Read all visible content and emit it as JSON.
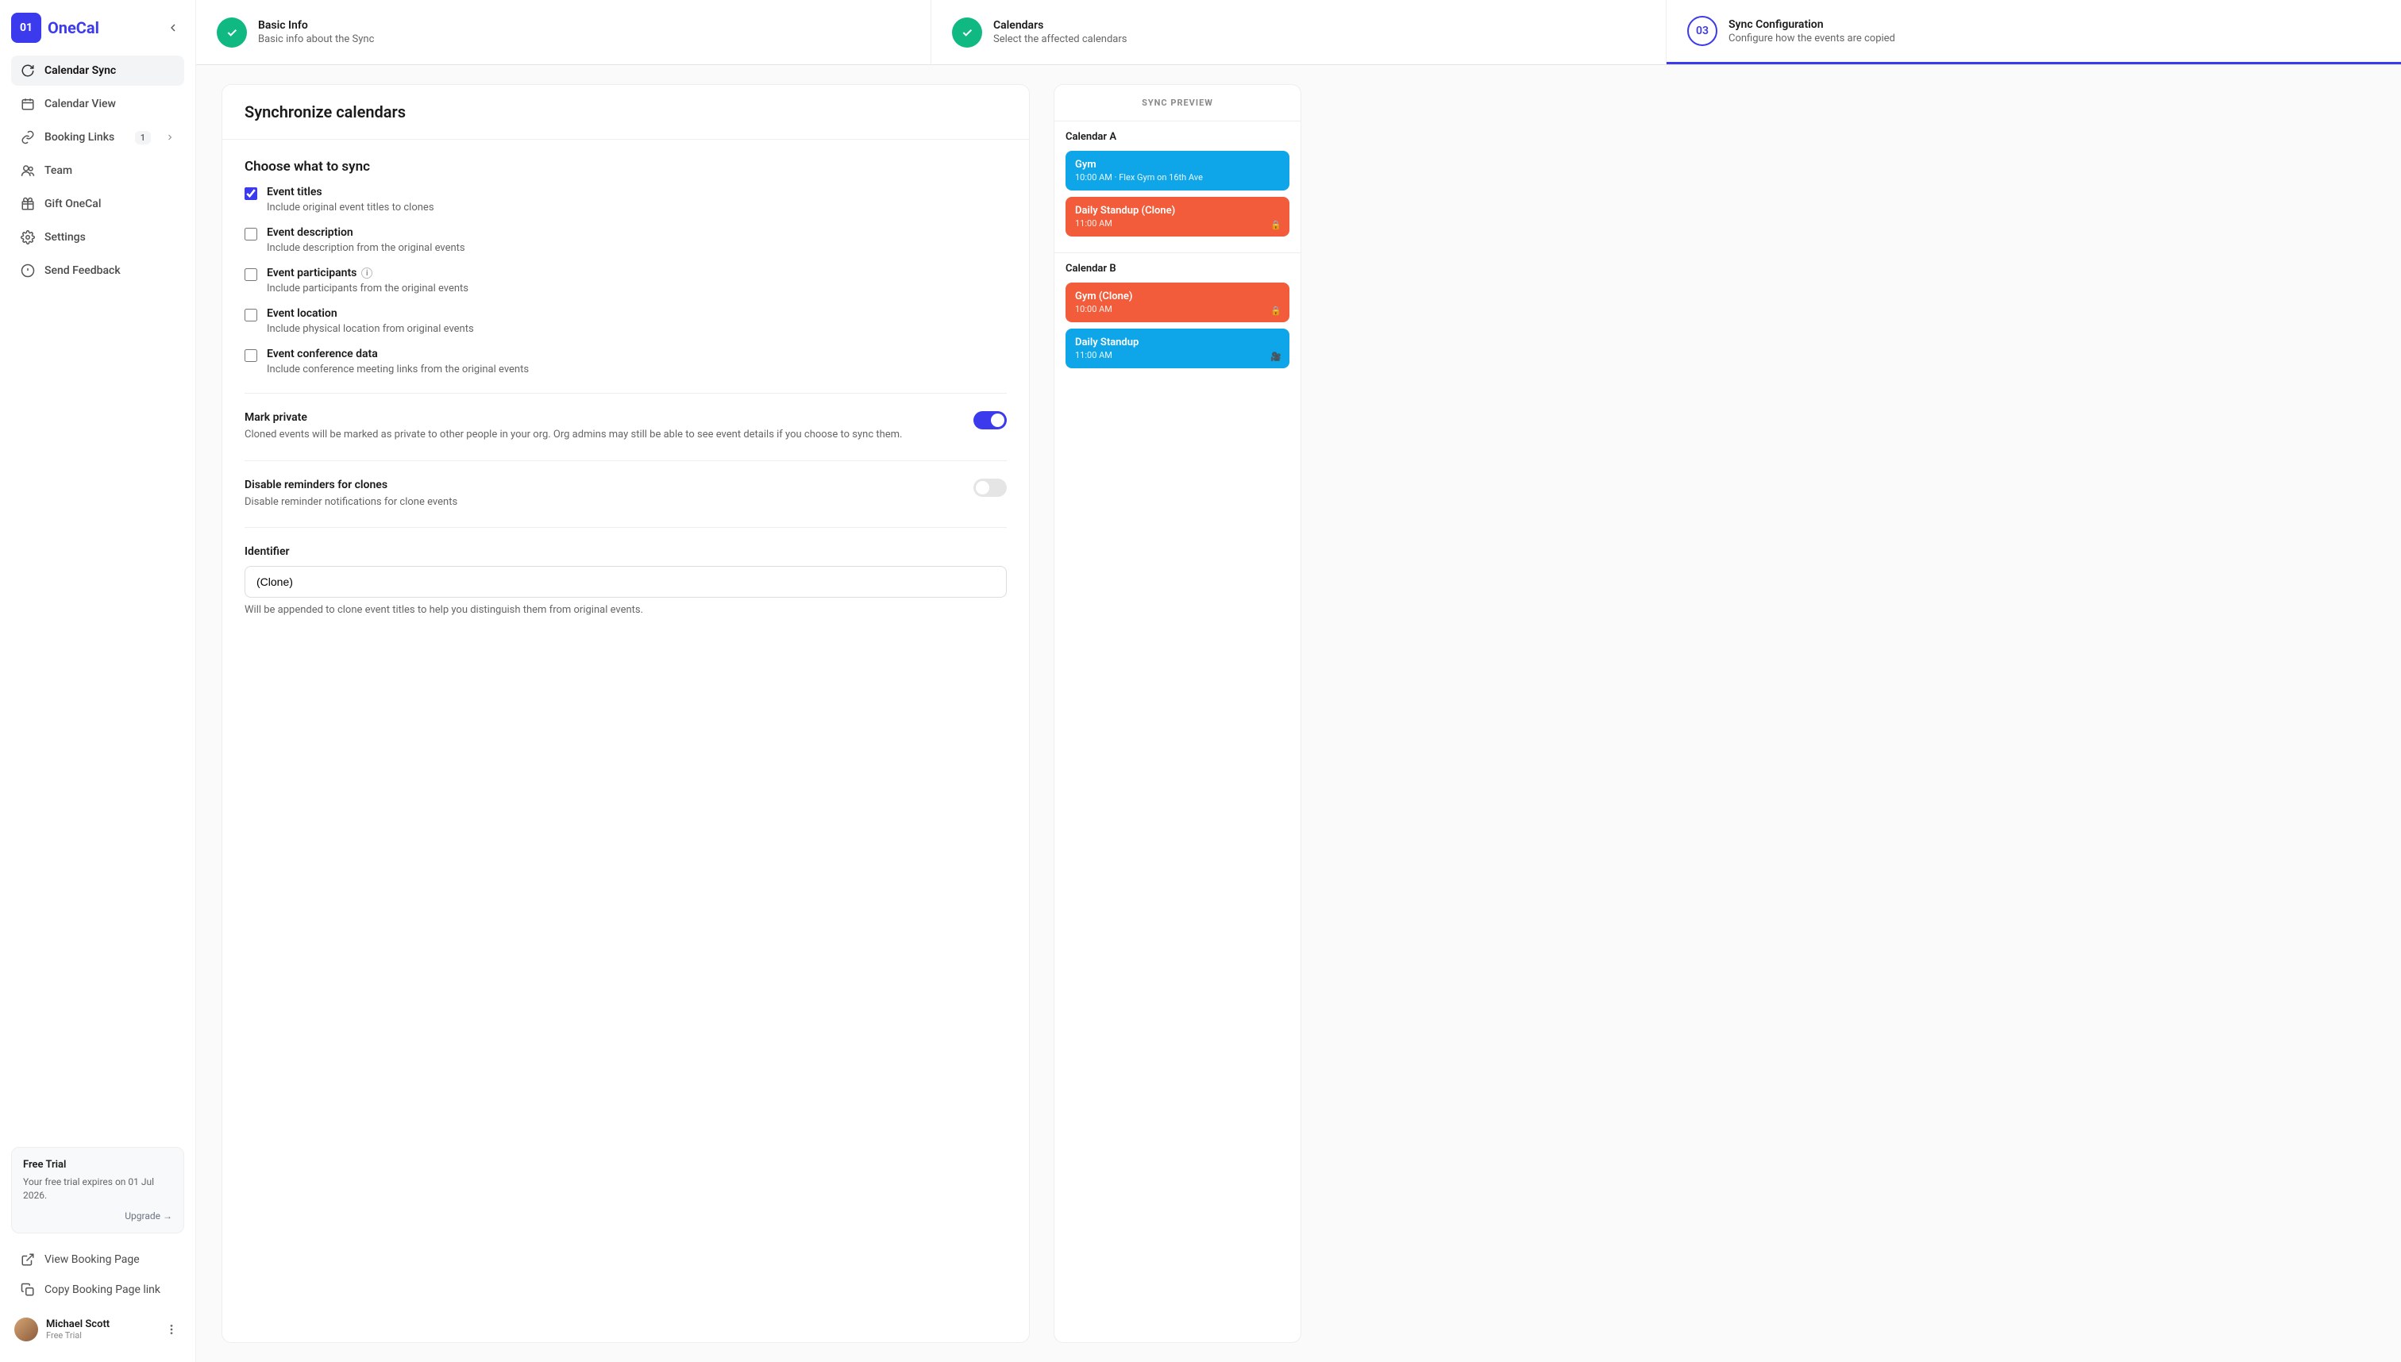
{
  "brand": {
    "mark": "01",
    "name": "OneCal"
  },
  "sidebar": {
    "items": [
      {
        "label": "Calendar Sync"
      },
      {
        "label": "Calendar View"
      },
      {
        "label": "Booking Links",
        "badge": "1"
      },
      {
        "label": "Team"
      },
      {
        "label": "Gift OneCal"
      },
      {
        "label": "Settings"
      },
      {
        "label": "Send Feedback"
      }
    ],
    "trial": {
      "title": "Free Trial",
      "desc": "Your free trial expires on 01 Jul 2026.",
      "upgrade": "Upgrade →"
    },
    "links": [
      {
        "label": "View Booking Page"
      },
      {
        "label": "Copy Booking Page link"
      }
    ],
    "user": {
      "name": "Michael Scott",
      "plan": "Free Trial"
    }
  },
  "stepper": [
    {
      "title": "Basic Info",
      "desc": "Basic info about the Sync",
      "state": "done"
    },
    {
      "title": "Calendars",
      "desc": "Select the affected calendars",
      "state": "done"
    },
    {
      "num": "03",
      "title": "Sync Configuration",
      "desc": "Configure how the events are copied",
      "state": "active"
    }
  ],
  "sync": {
    "heading": "Synchronize calendars",
    "choose_title": "Choose what to sync",
    "options": [
      {
        "label": "Event titles",
        "desc": "Include original event titles to clones",
        "checked": true
      },
      {
        "label": "Event description",
        "desc": "Include description from the original events",
        "checked": false
      },
      {
        "label": "Event participants",
        "desc": "Include participants from the original events",
        "checked": false,
        "info": true
      },
      {
        "label": "Event location",
        "desc": "Include physical location from original events",
        "checked": false
      },
      {
        "label": "Event conference data",
        "desc": "Include conference meeting links from the original events",
        "checked": false
      }
    ],
    "mark_private": {
      "title": "Mark private",
      "desc": "Cloned events will be marked as private to other people in your org. Org admins may still be able to see event details if you choose to sync them.",
      "on": true
    },
    "disable_reminders": {
      "title": "Disable reminders for clones",
      "desc": "Disable reminder notifications for clone events",
      "on": false
    },
    "identifier": {
      "label": "Identifier",
      "value": "(Clone)",
      "help": "Will be appended to clone event titles to help you distinguish them from original events."
    }
  },
  "preview": {
    "title": "SYNC PREVIEW",
    "calendars": [
      {
        "name": "Calendar A",
        "events": [
          {
            "title": "Gym",
            "time": "10:00 AM · Flex Gym on 16th Ave",
            "color": "blue"
          },
          {
            "title": "Daily Standup (Clone)",
            "time": "11:00 AM",
            "color": "orange",
            "icon": "lock"
          }
        ]
      },
      {
        "name": "Calendar B",
        "events": [
          {
            "title": "Gym (Clone)",
            "time": "10:00 AM",
            "color": "orange",
            "icon": "lock"
          },
          {
            "title": "Daily Standup",
            "time": "11:00 AM",
            "color": "blue",
            "icon": "video"
          }
        ]
      }
    ]
  }
}
